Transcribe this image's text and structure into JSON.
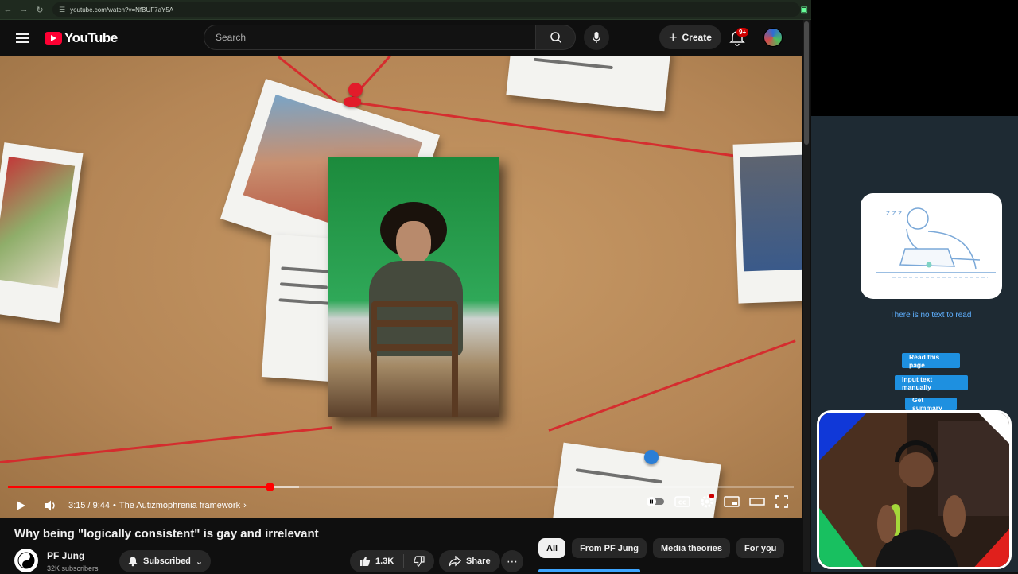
{
  "browser": {
    "url": "youtube.com/watch?v=NfBUF7aY5A"
  },
  "header": {
    "search_placeholder": "Search",
    "create_label": "Create",
    "notifications_badge": "9+"
  },
  "player": {
    "current_time": "3:15",
    "duration": "9:44",
    "time_display": "3:15 / 9:44",
    "chapter_separator": "•",
    "chapter": "The Autizmophrenia framework",
    "progress_fraction": 0.333,
    "buffer_fraction": 0.37
  },
  "video": {
    "title": "Why being \"logically consistent\" is gay and irrelevant"
  },
  "channel": {
    "name": "PF Jung",
    "subscribers": "32K subscribers",
    "subscribed_label": "Subscribed"
  },
  "actions": {
    "likes": "1.3K",
    "share_label": "Share"
  },
  "chips": [
    {
      "label": "All",
      "active": true
    },
    {
      "label": "From PF Jung",
      "active": false
    },
    {
      "label": "Media theories",
      "active": false
    },
    {
      "label": "For you",
      "active": false
    }
  ],
  "reader": {
    "empty_message": "There is no text to read",
    "read_page_label": "Read this page",
    "input_text_label": "Input text manually",
    "summary_label": "Get summary"
  },
  "colors": {
    "youtube_red": "#ff0033",
    "progress_red": "#ff0000",
    "reader_blue": "#1e90e0",
    "reader_bg": "#1e2a33"
  }
}
